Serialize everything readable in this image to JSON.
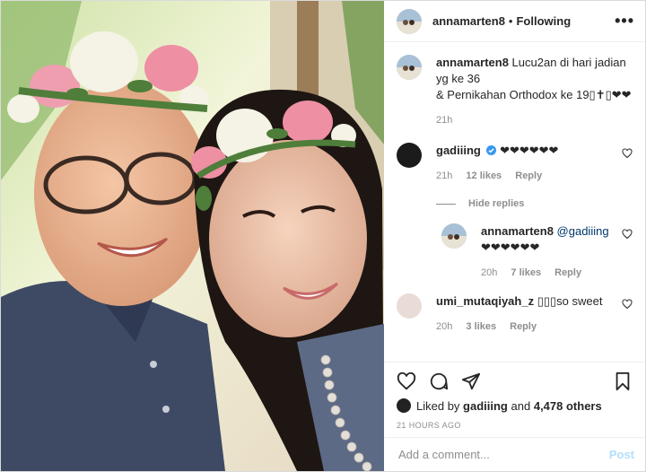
{
  "header": {
    "username": "annamarten8",
    "separator": "•",
    "follow_state": "Following",
    "more": "•••"
  },
  "caption": {
    "username": "annamarten8",
    "line1": "Lucu2an di hari jadian yg ke 36",
    "line2": "& Pernikahan Orthodox ke 19▯✝▯❤❤",
    "time": "21h"
  },
  "comments": [
    {
      "username": "gadiiing",
      "text": "❤❤❤❤❤❤",
      "time": "21h",
      "likes": "12 likes",
      "reply": "Reply"
    }
  ],
  "hide_replies": "Hide replies",
  "reply": {
    "username": "annamarten8",
    "mention": "@gadiiing",
    "text": "❤❤❤❤❤❤",
    "time": "20h",
    "likes": "7 likes",
    "reply": "Reply"
  },
  "comment2": {
    "username": "umi_mutaqiyah_z",
    "text": "▯▯▯so sweet",
    "time": "20h",
    "likes": "3 likes",
    "reply": "Reply"
  },
  "likes": {
    "prefix": "Liked by",
    "user": "gadiiing",
    "and": "and",
    "count": "4,478 others"
  },
  "timestamp": "21 HOURS AGO",
  "add_comment": {
    "placeholder": "Add a comment...",
    "post_label": "Post"
  },
  "colors": {
    "link": "#00376b",
    "post_disabled": "#b2dffc",
    "verified": "#3897f0"
  }
}
